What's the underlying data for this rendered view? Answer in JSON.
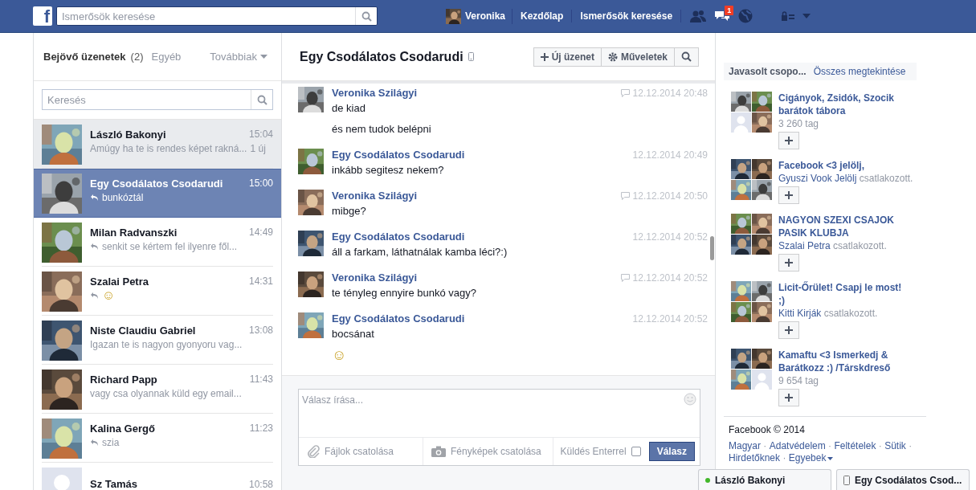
{
  "topbar": {
    "logo": "f",
    "search": {
      "placeholder": "Ismerősök keresése"
    },
    "profile": {
      "name": "Veronika"
    },
    "links": [
      "Kezdőlap",
      "Ismerősök keresése"
    ],
    "notifications": {
      "messages": "1"
    }
  },
  "inbox": {
    "title": "Bejövő üzenetek",
    "count": "(2)",
    "tabs": [
      {
        "label": "Egyéb"
      },
      {
        "label": "Továbbiak",
        "has_menu": true
      }
    ],
    "search": {
      "placeholder": "Keresés"
    },
    "conversations": [
      {
        "name": "László Bakonyi",
        "time": "15:04",
        "snippet": "Amúgy ha te is rendes képet rakná...",
        "new_count": "1 új",
        "replied": false,
        "unread": true,
        "selected": false,
        "silhouette": false
      },
      {
        "name": "Egy Csodálatos Csodarudi",
        "time": "15:00",
        "snippet": "bunkóztál",
        "replied": true,
        "unread": false,
        "selected": true,
        "silhouette": false
      },
      {
        "name": "Milan Radvanszki",
        "time": "14:49",
        "snippet": "senkit se kértem fel ilyenre fől...",
        "replied": true,
        "unread": false,
        "selected": false,
        "silhouette": false
      },
      {
        "name": "Szalai Petra",
        "time": "14:31",
        "snippet": "☺",
        "replied": true,
        "unread": false,
        "selected": false,
        "silhouette": false
      },
      {
        "name": "Niste Claudiu Gabriel",
        "time": "13:08",
        "snippet": "Igazan te is nagyon gyonyoru vag...",
        "replied": false,
        "unread": false,
        "selected": false,
        "silhouette": false
      },
      {
        "name": "Richard Papp",
        "time": "11:43",
        "snippet": "vagy csa olyannak küld egy email...",
        "replied": false,
        "unread": false,
        "selected": false,
        "silhouette": false
      },
      {
        "name": "Kalina Gergő",
        "time": "11:23",
        "snippet": "szia",
        "replied": true,
        "unread": false,
        "selected": false,
        "silhouette": false
      },
      {
        "name": "Sz Tamás",
        "time": "10:58",
        "unread": false,
        "selected": false,
        "silhouette": true
      }
    ]
  },
  "conversation": {
    "title": "Egy Csodálatos Csodarudi",
    "mobile": true,
    "buttons": [
      {
        "kind": "new",
        "label": "Új üzenet"
      },
      {
        "kind": "actions",
        "label": "Műveletek"
      },
      {
        "kind": "search"
      }
    ],
    "messages": [
      {
        "sender": "Veronika Szilágyi",
        "time": "12.12.2014 20:48",
        "seen_icon": true,
        "lines": [
          "de kiad",
          "és nem tudok belépni"
        ]
      },
      {
        "sender": "Egy Csodálatos Csodarudi",
        "time": "12.12.2014 20:49",
        "seen_icon": false,
        "lines": [
          "inkább segitesz nekem?"
        ]
      },
      {
        "sender": "Veronika Szilágyi",
        "time": "12.12.2014 20:50",
        "seen_icon": true,
        "lines": [
          "mibge?"
        ]
      },
      {
        "sender": "Egy Csodálatos Csodarudi",
        "time": "12.12.2014 20:52",
        "seen_icon": false,
        "lines": [
          "áll a farkam, láthatnálak kamba léci?:)"
        ]
      },
      {
        "sender": "Veronika Szilágyi",
        "time": "12.12.2014 20:52",
        "seen_icon": true,
        "lines": [
          "te tényleg ennyire bunkó vagy?"
        ]
      },
      {
        "sender": "Egy Csodálatos Csodarudi",
        "time": "12.12.2014 20:52",
        "seen_icon": false,
        "lines": [
          "bocsánat",
          "☺"
        ]
      }
    ],
    "composer": {
      "placeholder": "Válasz írása...",
      "attach_files": "Fájlok csatolása",
      "attach_photos": "Fényképek csatolása",
      "enter_to_send": {
        "label": "Küldés Enterrel",
        "checked": false
      },
      "send": "Válasz"
    }
  },
  "suggested_groups": {
    "title": "Javasolt csopo...",
    "see_all": "Összes megtekintése",
    "groups": [
      {
        "name": "Cigányok, Zsidók, Szocik barátok tábora",
        "kind": "members",
        "members": "3 260 tag",
        "thumbs": [
          {
            "silhouette": false
          },
          {
            "silhouette": false
          },
          {
            "silhouette": true
          },
          {
            "silhouette": false
          }
        ]
      },
      {
        "name": "Facebook <3 jelölj,",
        "kind": "joined",
        "person": "Gyuszi Vook Jelölj",
        "note": "csatlakozott.",
        "thumbs": [
          {
            "silhouette": false
          },
          {
            "silhouette": false
          },
          {
            "silhouette": false
          },
          {
            "silhouette": false
          }
        ]
      },
      {
        "name": "NAGYON SZEXI CSAJOK PASIK KLUBJA",
        "kind": "joined",
        "person": "Szalai Petra",
        "note": "csatlakozott.",
        "thumbs": [
          {
            "silhouette": false
          },
          {
            "silhouette": false
          },
          {
            "silhouette": false
          },
          {
            "silhouette": false
          }
        ]
      },
      {
        "name": "Licit-Őrület! Csapj le most! ;)",
        "kind": "joined",
        "person": "Kitti Kirják",
        "note": "csatlakozott.",
        "thumbs": [
          {
            "silhouette": false
          },
          {
            "silhouette": false
          },
          {
            "silhouette": false
          },
          {
            "silhouette": false
          }
        ]
      },
      {
        "name": "Kamaftu <3 Ismerkedj & Barátkozz :) /Társkdreső",
        "kind": "members",
        "members": "9 654 tag",
        "thumbs": [
          {
            "silhouette": false
          },
          {
            "silhouette": false
          },
          {
            "silhouette": false
          },
          {
            "silhouette": true
          }
        ]
      }
    ]
  },
  "footer": {
    "copyright": "Facebook © 2014",
    "separator": "·",
    "links": [
      {
        "label": "Magyar"
      },
      {
        "label": "Adatvédelem"
      },
      {
        "label": "Feltételek"
      },
      {
        "label": "Sütik"
      },
      {
        "label": "Hirdetőknek"
      },
      {
        "label": "Egyebek",
        "has_menu": true
      }
    ]
  },
  "chat_tabs": [
    {
      "name": "László Bakonyi",
      "online": true,
      "mobile": false
    },
    {
      "name": "Egy Csodálatos Csod...",
      "online": false,
      "mobile": true
    }
  ]
}
